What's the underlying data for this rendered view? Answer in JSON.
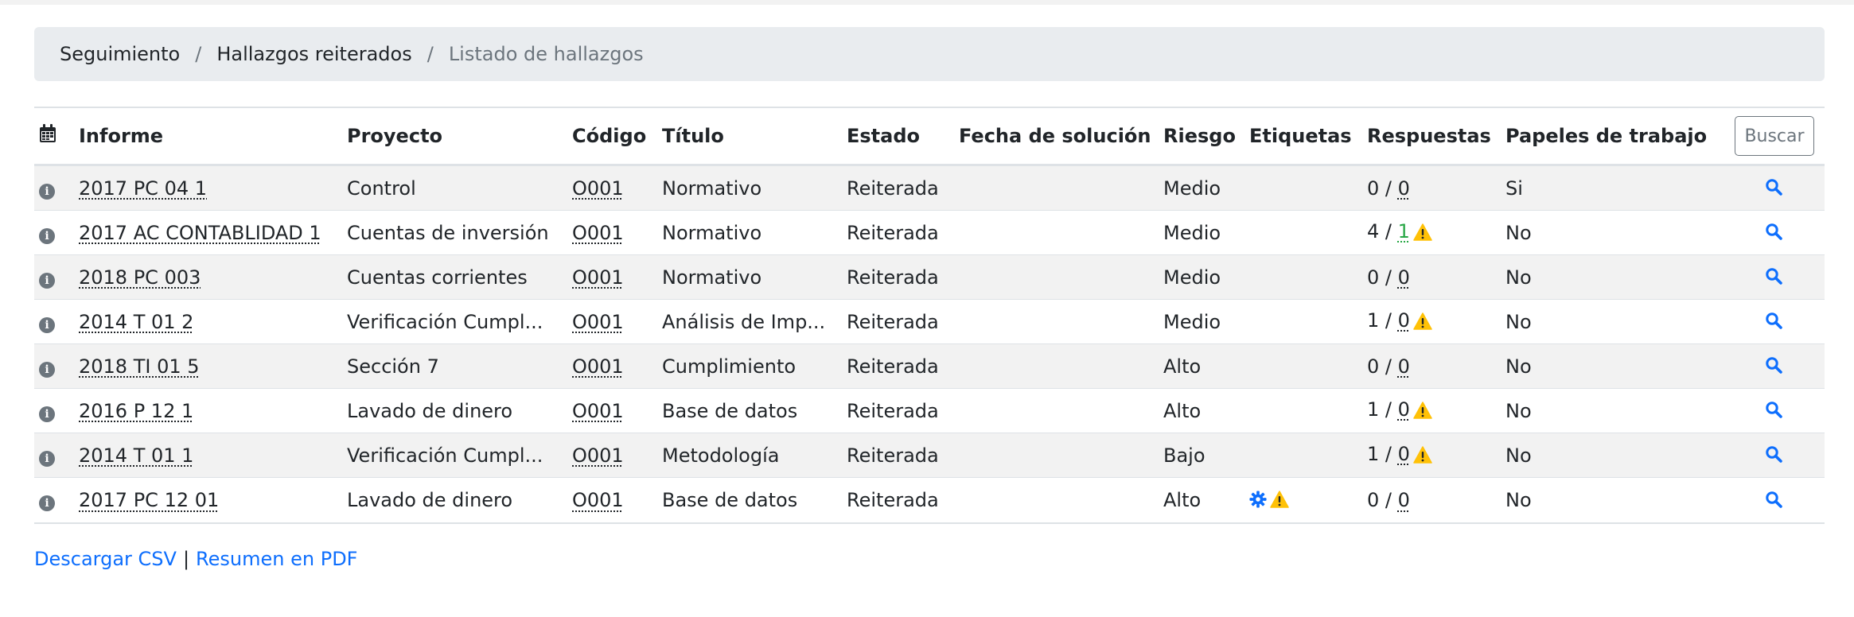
{
  "breadcrumb": {
    "items": [
      "Seguimiento",
      "Hallazgos reiterados"
    ],
    "active": "Listado de hallazgos",
    "separator": "/"
  },
  "table": {
    "headers": {
      "informe": "Informe",
      "proyecto": "Proyecto",
      "codigo": "Código",
      "titulo": "Título",
      "estado": "Estado",
      "fecha": "Fecha de solución",
      "riesgo": "Riesgo",
      "etiquetas": "Etiquetas",
      "respuestas": "Respuestas",
      "papeles": "Papeles de trabajo"
    },
    "search_button": "Buscar",
    "rows": [
      {
        "informe": "2017 PC 04 1",
        "proyecto": "Control",
        "codigo": "O001",
        "titulo": "Normativo",
        "estado": "Reiterada",
        "fecha": "",
        "riesgo": "Medio",
        "resp_a": "0",
        "resp_b": "0",
        "papeles": "Si"
      },
      {
        "informe": "2017 AC CONTABLIDAD 1",
        "proyecto": "Cuentas de inversión",
        "codigo": "O001",
        "titulo": "Normativo",
        "estado": "Reiterada",
        "fecha": "",
        "riesgo": "Medio",
        "resp_a": "4",
        "resp_b": "1",
        "papeles": "No"
      },
      {
        "informe": "2018 PC 003",
        "proyecto": "Cuentas corrientes",
        "codigo": "O001",
        "titulo": "Normativo",
        "estado": "Reiterada",
        "fecha": "",
        "riesgo": "Medio",
        "resp_a": "0",
        "resp_b": "0",
        "papeles": "No"
      },
      {
        "informe": "2014 T 01 2",
        "proyecto": "Verificación Cumpl...",
        "codigo": "O001",
        "titulo": "Análisis de Imp...",
        "estado": "Reiterada",
        "fecha": "",
        "riesgo": "Medio",
        "resp_a": "1",
        "resp_b": "0",
        "papeles": "No"
      },
      {
        "informe": "2018 TI 01 5",
        "proyecto": "Sección 7",
        "codigo": "O001",
        "titulo": "Cumplimiento",
        "estado": "Reiterada",
        "fecha": "",
        "riesgo": "Alto",
        "resp_a": "0",
        "resp_b": "0",
        "papeles": "No"
      },
      {
        "informe": "2016 P 12 1",
        "proyecto": "Lavado de dinero",
        "codigo": "O001",
        "titulo": "Base de datos",
        "estado": "Reiterada",
        "fecha": "",
        "riesgo": "Alto",
        "resp_a": "1",
        "resp_b": "0",
        "papeles": "No"
      },
      {
        "informe": "2014 T 01 1",
        "proyecto": "Verificación Cumpl...",
        "codigo": "O001",
        "titulo": "Metodología",
        "estado": "Reiterada",
        "fecha": "",
        "riesgo": "Bajo",
        "resp_a": "1",
        "resp_b": "0",
        "papeles": "No"
      },
      {
        "informe": "2017 PC 12 01",
        "proyecto": "Lavado de dinero",
        "codigo": "O001",
        "titulo": "Base de datos",
        "estado": "Reiterada",
        "fecha": "",
        "riesgo": "Alto",
        "resp_a": "0",
        "resp_b": "0",
        "papeles": "No"
      }
    ]
  },
  "footer": {
    "csv_link": "Descargar CSV",
    "separator": "|",
    "pdf_link": "Resumen en PDF"
  },
  "colors": {
    "link": "#0d6efd",
    "warning": "#ffc107",
    "success": "#28a745",
    "info_icon": "#6c757d"
  }
}
